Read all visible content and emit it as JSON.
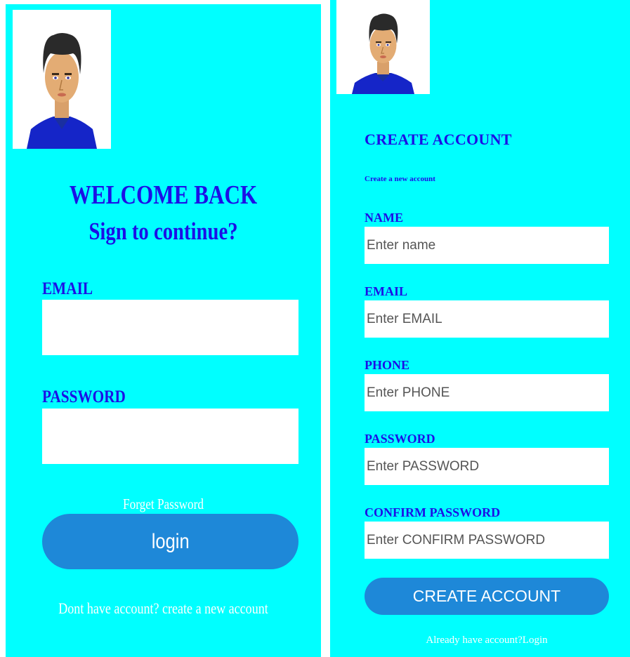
{
  "login": {
    "title": "WELCOME BACK",
    "subtitle": "Sign to continue?",
    "email_label": "EMAIL",
    "email_value": "",
    "password_label": "PASSWORD",
    "password_value": "",
    "forgot_link": "Forget Password",
    "login_button": "login",
    "create_account_link": "Dont have account? create a new account"
  },
  "signup": {
    "title": "CREATE ACCOUNT",
    "subtitle": "Create a new account",
    "fields": [
      {
        "label": "NAME",
        "placeholder": "Enter name"
      },
      {
        "label": "EMAIL",
        "placeholder": "Enter EMAIL"
      },
      {
        "label": "PHONE",
        "placeholder": "Enter PHONE"
      },
      {
        "label": "PASSWORD",
        "placeholder": "Enter PASSWORD"
      },
      {
        "label": "CONFIRM PASSWORD",
        "placeholder": "Enter CONFIRM PASSWORD"
      }
    ],
    "create_button": "CREATE ACCOUNT",
    "login_link": "Already have account?Login"
  },
  "colors": {
    "background": "#00ffff",
    "accent_text": "#1c10e6",
    "button": "#1e88d8",
    "input_bg": "#ffffff"
  },
  "icons": {
    "avatar": "user-avatar-icon"
  }
}
